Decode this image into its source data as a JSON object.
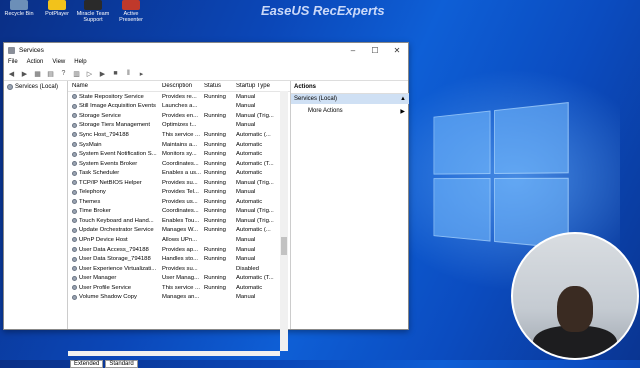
{
  "desktop": {
    "icons": [
      {
        "label": "Recycle Bin",
        "color": "#6c8fb8"
      },
      {
        "label": "PotPlayer",
        "color": "#f2c21b"
      },
      {
        "label": "Miracle Team Support",
        "color": "#2a2a2a"
      },
      {
        "label": "Active Presenter",
        "color": "#c0392b"
      }
    ],
    "watermark": "EaseUS RecExperts"
  },
  "window": {
    "title": "Services",
    "controls": {
      "minimize": "–",
      "maximize": "☐",
      "close": "✕"
    },
    "menu": [
      "File",
      "Action",
      "View",
      "Help"
    ],
    "toolbar_icons": [
      "back-icon",
      "forward-icon",
      "show-hide-tree-icon",
      "properties-icon",
      "help-icon",
      "export-icon",
      "play-icon",
      "play-alt-icon",
      "stop-icon",
      "pause-icon",
      "restart-icon"
    ],
    "tree_node": "Services (Local)",
    "columns": {
      "name": "Name",
      "description": "Description",
      "status": "Status",
      "startup": "Startup Type"
    },
    "services": [
      {
        "name": "State Repository Service",
        "desc": "Provides re...",
        "status": "Running",
        "startup": "Manual"
      },
      {
        "name": "Still Image Acquisition Events",
        "desc": "Launches a...",
        "status": "",
        "startup": "Manual"
      },
      {
        "name": "Storage Service",
        "desc": "Provides en...",
        "status": "Running",
        "startup": "Manual (Trig..."
      },
      {
        "name": "Storage Tiers Management",
        "desc": "Optimizes t...",
        "status": "",
        "startup": "Manual"
      },
      {
        "name": "Sync Host_794188",
        "desc": "This service ...",
        "status": "Running",
        "startup": "Automatic (..."
      },
      {
        "name": "SysMain",
        "desc": "Maintains a...",
        "status": "Running",
        "startup": "Automatic"
      },
      {
        "name": "System Event Notification S...",
        "desc": "Monitors sy...",
        "status": "Running",
        "startup": "Automatic"
      },
      {
        "name": "System Events Broker",
        "desc": "Coordinates...",
        "status": "Running",
        "startup": "Automatic (T..."
      },
      {
        "name": "Task Scheduler",
        "desc": "Enables a us...",
        "status": "Running",
        "startup": "Automatic"
      },
      {
        "name": "TCP/IP NetBIOS Helper",
        "desc": "Provides su...",
        "status": "Running",
        "startup": "Manual (Trig..."
      },
      {
        "name": "Telephony",
        "desc": "Provides Tel...",
        "status": "Running",
        "startup": "Manual"
      },
      {
        "name": "Themes",
        "desc": "Provides us...",
        "status": "Running",
        "startup": "Automatic"
      },
      {
        "name": "Time Broker",
        "desc": "Coordinates...",
        "status": "Running",
        "startup": "Manual (Trig..."
      },
      {
        "name": "Touch Keyboard and Hand...",
        "desc": "Enables Tou...",
        "status": "Running",
        "startup": "Manual (Trig..."
      },
      {
        "name": "Update Orchestrator Service",
        "desc": "Manages W...",
        "status": "Running",
        "startup": "Automatic (..."
      },
      {
        "name": "UPnP Device Host",
        "desc": "Allows UPn...",
        "status": "",
        "startup": "Manual"
      },
      {
        "name": "User Data Access_794188",
        "desc": "Provides ap...",
        "status": "Running",
        "startup": "Manual"
      },
      {
        "name": "User Data Storage_794188",
        "desc": "Handles sto...",
        "status": "Running",
        "startup": "Manual"
      },
      {
        "name": "User Experience Virtualizati...",
        "desc": "Provides su...",
        "status": "",
        "startup": "Disabled"
      },
      {
        "name": "User Manager",
        "desc": "User Manag...",
        "status": "Running",
        "startup": "Automatic (T..."
      },
      {
        "name": "User Profile Service",
        "desc": "This service ...",
        "status": "Running",
        "startup": "Automatic"
      },
      {
        "name": "Volume Shadow Copy",
        "desc": "Manages an...",
        "status": "",
        "startup": "Manual"
      }
    ],
    "tabs": [
      "Extended",
      "Standard"
    ],
    "actions": {
      "header": "Actions",
      "selected": "Services (Local)",
      "more": "More Actions",
      "arrow": "▲",
      "more_arrow": "▶"
    }
  }
}
